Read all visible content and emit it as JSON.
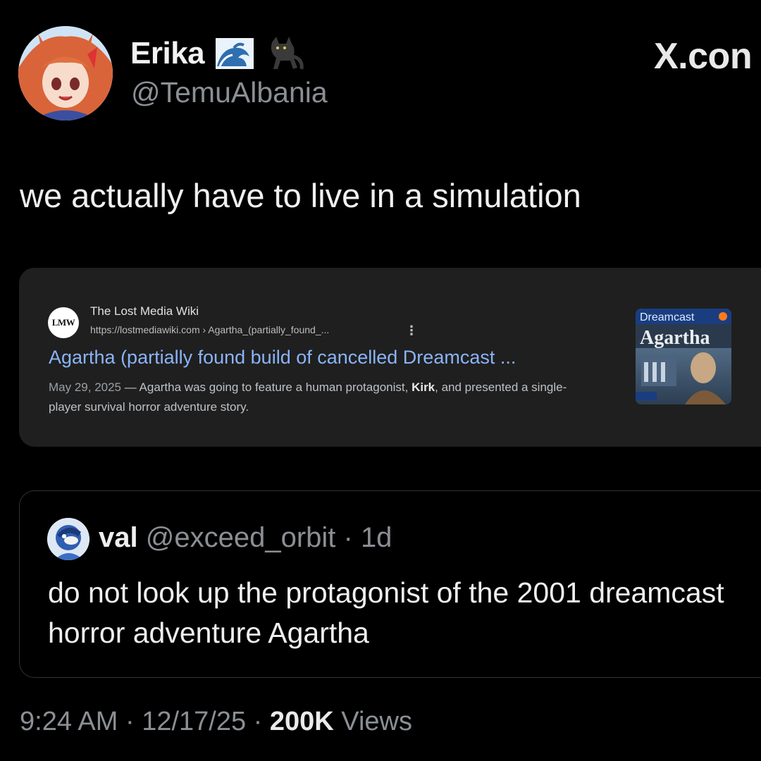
{
  "author": {
    "display_name": "Erika",
    "handle": "@TemuAlbania",
    "avatar_icon": "anime-girl-avatar",
    "name_emojis": [
      "wave-icon",
      "black-cat-icon"
    ]
  },
  "watermark": "X.con",
  "tweet": {
    "text": "we actually have to live in a simulation"
  },
  "search_result": {
    "site_logo": "LMW",
    "site_name": "The Lost Media Wiki",
    "url": "https://lostmediawiki.com › Agartha_(partially_found_...",
    "more_icon": "kebab-menu-icon",
    "title": "Agartha (partially found build of cancelled Dreamcast ...",
    "date": "May 29, 2025",
    "snippet_before": " — Agartha was going to feature a human protagonist, ",
    "snippet_bold": "Kirk",
    "snippet_after": ", and presented a single-player survival horror adventure story.",
    "thumbnail": {
      "brand": "Dreamcast",
      "game_title": "Agartha"
    }
  },
  "quote": {
    "name": "val",
    "handle": "@exceed_orbit",
    "separator": " · ",
    "age": "1d",
    "avatar_icon": "blue-character-avatar",
    "text": "do not look up the protagonist of the 2001 dreamcast horror adventure Agartha"
  },
  "footer": {
    "time": "9:24 AM",
    "sep1": " · ",
    "date": "12/17/25",
    "sep2": " · ",
    "views_count": "200K",
    "views_label": " Views"
  },
  "colors": {
    "background": "#000000",
    "link_blue": "#8ab4f8",
    "muted": "#8b8f94",
    "card_bg": "#1f1f1f"
  }
}
